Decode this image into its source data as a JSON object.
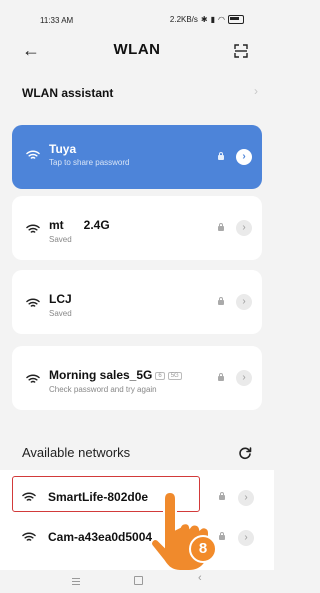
{
  "status_bar": {
    "time": "11:33 AM",
    "right_info": "2.2KB/s"
  },
  "header": {
    "title": "WLAN",
    "back_icon": "arrow-left-icon",
    "scan_icon": "scan-icon"
  },
  "assistant": {
    "label": "WLAN assistant"
  },
  "saved_networks": [
    {
      "name": "Tuya",
      "subtitle": "Tap to share password",
      "connected": true
    },
    {
      "name": "mt      2.4G",
      "subtitle": "Saved",
      "connected": false
    },
    {
      "name": "LCJ",
      "subtitle": "Saved",
      "connected": false
    },
    {
      "name": "Morning sales_5G",
      "tags": [
        "6",
        "5G"
      ],
      "subtitle": "Check password and try again",
      "connected": false
    }
  ],
  "available": {
    "heading": "Available networks",
    "networks": [
      {
        "name": "SmartLife-802d0e",
        "highlighted": true
      },
      {
        "name": "Cam-a43ea0d5004"
      }
    ]
  },
  "step_badge": "8",
  "colors": {
    "accent": "#4d84d9",
    "highlight": "#d23a3a",
    "badge": "#f28b2a"
  }
}
